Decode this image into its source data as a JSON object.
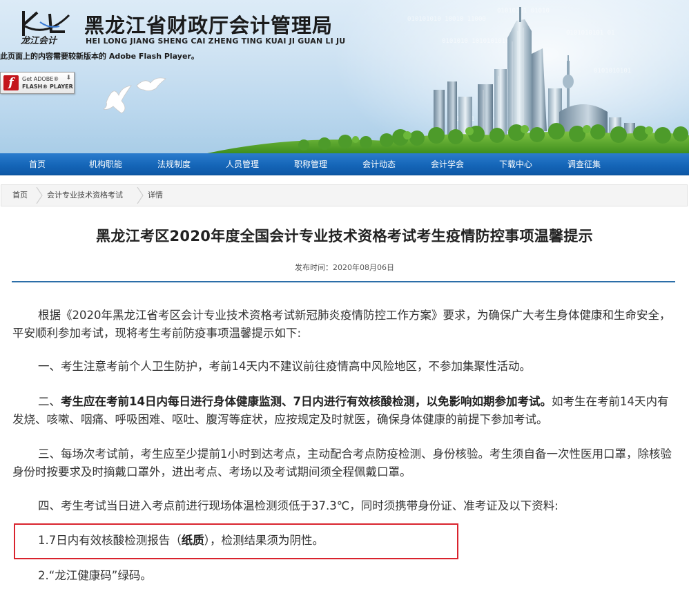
{
  "header": {
    "logo_subtitle": "龙江会计",
    "site_title": "黑龙江省财政厅会计管理局",
    "site_pinyin": "HEI LONG JIANG SHENG CAI ZHENG TING KUAI JI GUAN LI JU",
    "flash_notice": "此页面上的内容需要较新版本的 Adobe Flash Player。",
    "flash_badge": {
      "line1": "Get ADOBE®",
      "line2": "FLASH® PLAYER"
    }
  },
  "nav": {
    "items": [
      "首页",
      "机构职能",
      "法规制度",
      "人员管理",
      "职称管理",
      "会计动态",
      "会计学会",
      "下载中心",
      "调查征集"
    ]
  },
  "breadcrumb": {
    "items": [
      "首页",
      "会计专业技术资格考试",
      "详情"
    ]
  },
  "article": {
    "title": "黑龙江考区2020年度全国会计专业技术资格考试考生疫情防控事项温馨提示",
    "publish_label": "发布时间：",
    "publish_date": "2020年08月06日",
    "p1": "根据《2020年黑龙江省考区会计专业技术资格考试新冠肺炎疫情防控工作方案》要求，为确保广大考生身体健康和生命安全，平安顺利参加考试，现将考生考前防疫事项温馨提示如下:",
    "p2": "一、考生注意考前个人卫生防护，考前14天内不建议前往疫情高中风险地区，不参加集聚性活动。",
    "p3_lead": "二、",
    "p3_bold": "考生应在考前14日内每日进行身体健康监测、7日内进行有效核酸检测，以免影响如期参加考试。",
    "p3_rest": "如考生在考前14天内有发烧、咳嗽、咽痛、呼吸困难、呕吐、腹泻等症状，应按规定及时就医，确保身体健康的前提下参加考试。",
    "p4": "三、每场次考试前，考生应至少提前1小时到达考点，主动配合考点防疫检测、身份核验。考生须自备一次性医用口罩，除核验身份时按要求及时摘戴口罩外，进出考点、考场以及考试期间须全程佩戴口罩。",
    "p5": "四、考生考试当日进入考点前进行现场体温检测须低于37.3℃，同时须携带身份证、准考证及以下资料:",
    "item1_a": "1.7日内有效核酸检测报告（",
    "item1_bold": "纸质",
    "item1_b": "），检测结果须为阴性。",
    "item2": "2.“龙江健康码”绿码。"
  },
  "colors": {
    "nav_blue": "#1566b8",
    "rule_blue": "#2b6ea8",
    "highlight_red": "#d9232d"
  }
}
